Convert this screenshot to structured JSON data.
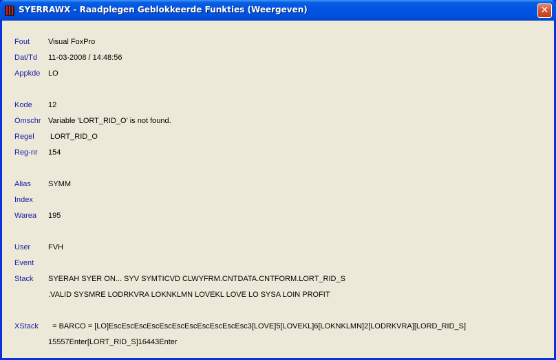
{
  "window": {
    "title": "SYERRAWX - Raadplegen Geblokkeerde Funkties (Weergeven)",
    "close_glyph": "✕"
  },
  "fields": {
    "fout": {
      "label": "Fout",
      "value": "Visual FoxPro"
    },
    "dattd": {
      "label": "Dat/Td",
      "value": "11-03-2008 / 14:48:56"
    },
    "appkde": {
      "label": "Appkde",
      "value": "LO"
    },
    "kode": {
      "label": "Kode",
      "value": "12"
    },
    "omschr": {
      "label": "Omschr",
      "value": "Variable 'LORT_RID_O' is not found."
    },
    "regel": {
      "label": "Regel",
      "value": " LORT_RID_O"
    },
    "regnr": {
      "label": "Reg-nr",
      "value": "154"
    },
    "alias": {
      "label": "Alias",
      "value": "SYMM"
    },
    "index": {
      "label": "Index",
      "value": ""
    },
    "warea": {
      "label": "Warea",
      "value": "195"
    },
    "user": {
      "label": "User",
      "value": "FVH"
    },
    "event": {
      "label": "Event",
      "value": ""
    },
    "stack": {
      "label": "Stack",
      "value": "SYERAH SYER ON... SYV SYMTICVD CLWYFRM.CNTDATA.CNTFORM.LORT_RID_S",
      "value2": ".VALID SYSMRE LODRKVRA LOKNKLMN LOVEKL LOVE LO SYSA LOIN PROFIT"
    },
    "xstack": {
      "label": "XStack",
      "value": "  = BARCO = [LO]EscEscEscEscEscEscEscEscEscEscEsc3[LOVE]5[LOVEKL]6[LOKNKLMN]2[LODRKVRA][LORD_RID_S]",
      "value2": "15557Enter[LORT_RID_S]16443Enter"
    }
  },
  "colors": {
    "label": "#1a1aa8",
    "value": "#000000",
    "background": "#ece9d8",
    "titlebar": "#0054e3"
  }
}
